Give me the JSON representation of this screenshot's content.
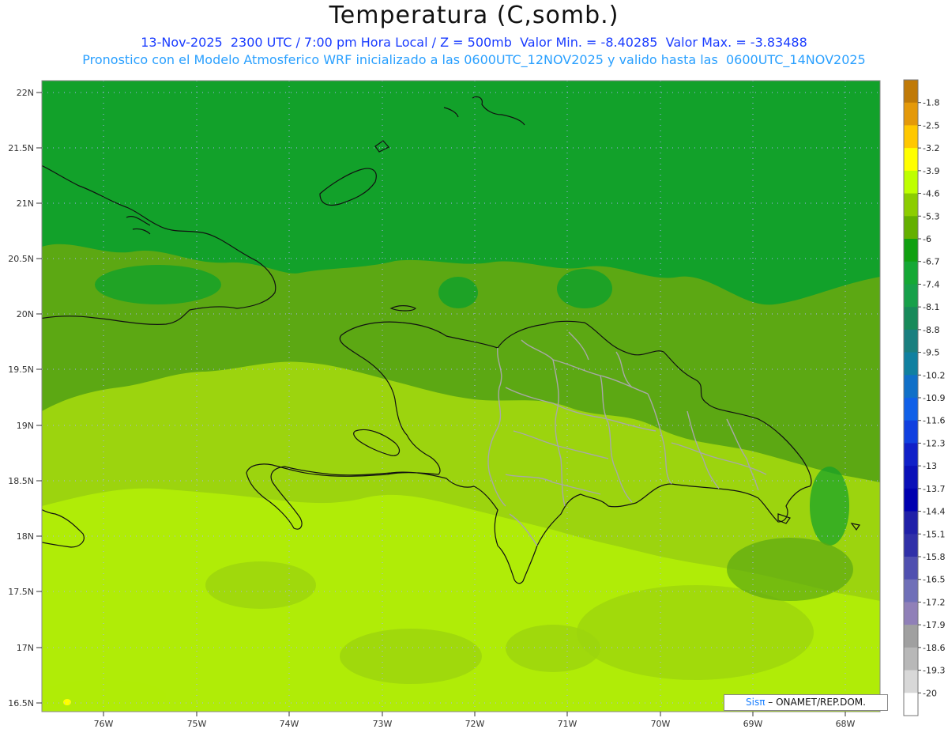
{
  "header": {
    "title": "Temperatura (C,somb.)",
    "line1": "13-Nov-2025  2300 UTC / 7:00 pm Hora Local / Z = 500mb  Valor Min. = -8.40285  Valor Max. = -3.83488",
    "line2": "Pronostico con el Modelo Atmosferico WRF inicializado a las 0600UTC_12NOV2025 y valido hasta las  0600UTC_14NOV2025"
  },
  "map": {
    "lat_labels": [
      "22N",
      "21.5N",
      "21N",
      "20.5N",
      "20N",
      "19.5N",
      "19N",
      "18.5N",
      "18N",
      "17.5N",
      "17N",
      "16.5N"
    ],
    "lon_labels": [
      "76W",
      "75W",
      "74W",
      "73W",
      "72W",
      "71W",
      "70W",
      "69W",
      "68W"
    ],
    "fill_colors": {
      "dark_green": "#12a12a",
      "mid_green": "#5ca813",
      "light_green": "#9cd40e",
      "lime": "#b0ec07"
    }
  },
  "colorbar": {
    "labels": [
      "-1.8",
      "-2.5",
      "-3.2",
      "-3.9",
      "-4.6",
      "-5.3",
      "-6",
      "-6.7",
      "-7.4",
      "-8.1",
      "-8.8",
      "-9.5",
      "-10.2",
      "-10.9",
      "-11.6",
      "-12.3",
      "-13",
      "-13.7",
      "-14.4",
      "-15.1",
      "-15.8",
      "-16.5",
      "-17.2",
      "-17.9",
      "-18.6",
      "-19.3",
      "-20"
    ],
    "colors": [
      "#c07a08",
      "#e4990a",
      "#ffc800",
      "#ffff00",
      "#bfff00",
      "#8ccd00",
      "#64b000",
      "#10a010",
      "#15a835",
      "#17a04a",
      "#188a5a",
      "#1a7f7f",
      "#1080a0",
      "#1070c8",
      "#1060e8",
      "#1040e0",
      "#1020c8",
      "#0a10b8",
      "#0000b0",
      "#2020a8",
      "#3030a8",
      "#5050b0",
      "#7070b8",
      "#9080b8",
      "#a0a0a0",
      "#b8b8b8",
      "#d8d8d8",
      "#ffffff"
    ]
  },
  "credit": {
    "brand": "Sisπ",
    "text": "– ONAMET/REP.DOM."
  }
}
